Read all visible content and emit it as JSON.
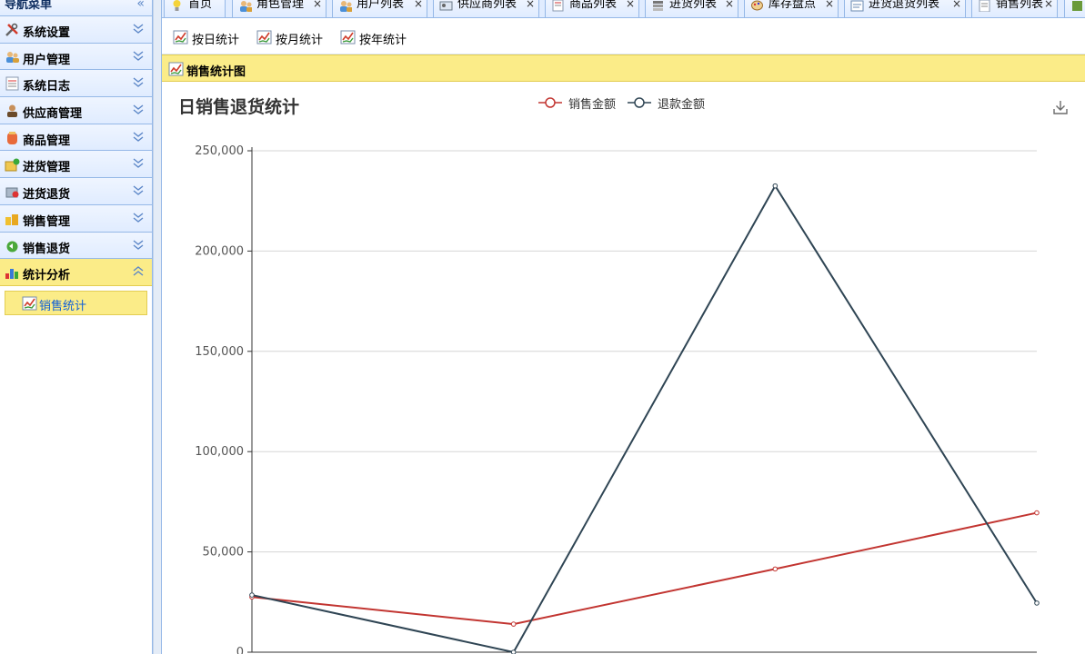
{
  "sidebar": {
    "title": "导航菜单",
    "collapse_glyph": "«",
    "panels": [
      {
        "label": "系统设置",
        "icon": "tools-icon",
        "active": false
      },
      {
        "label": "用户管理",
        "icon": "users-icon",
        "active": false
      },
      {
        "label": "系统日志",
        "icon": "log-icon",
        "active": false
      },
      {
        "label": "供应商管理",
        "icon": "supplier-icon",
        "active": false
      },
      {
        "label": "商品管理",
        "icon": "product-icon",
        "active": false
      },
      {
        "label": "进货管理",
        "icon": "purchase-icon",
        "active": false
      },
      {
        "label": "进货退货",
        "icon": "purchase-return-icon",
        "active": false
      },
      {
        "label": "销售管理",
        "icon": "sales-icon",
        "active": false
      },
      {
        "label": "销售退货",
        "icon": "sales-return-icon",
        "active": false
      },
      {
        "label": "统计分析",
        "icon": "bar-chart-icon",
        "active": true
      }
    ],
    "submenu": [
      {
        "label": "销售统计",
        "icon": "line-chart-icon"
      }
    ]
  },
  "tabs": [
    {
      "label": "首页",
      "icon": "bulb-icon",
      "closable": false
    },
    {
      "label": "角色管理",
      "icon": "users-icon",
      "closable": true
    },
    {
      "label": "用户列表",
      "icon": "users-icon",
      "closable": true
    },
    {
      "label": "供应商列表",
      "icon": "id-card-icon",
      "closable": true
    },
    {
      "label": "商品列表",
      "icon": "list-icon",
      "closable": true
    },
    {
      "label": "进货列表",
      "icon": "stack-icon",
      "closable": true
    },
    {
      "label": "库存盘点",
      "icon": "palette-icon",
      "closable": true
    },
    {
      "label": "进货退货列表",
      "icon": "form-icon",
      "closable": true
    },
    {
      "label": "销售列表",
      "icon": "doc-icon",
      "closable": true
    }
  ],
  "close_glyph": "×",
  "toolbar": {
    "buttons": [
      {
        "label": "按日统计",
        "icon": "line-chart-icon"
      },
      {
        "label": "按月统计",
        "icon": "line-chart-icon"
      },
      {
        "label": "按年统计",
        "icon": "line-chart-icon"
      }
    ]
  },
  "chart_panel": {
    "title": "销售统计图"
  },
  "colors": {
    "sales": "#c23531",
    "refund": "#2f4554",
    "accent": "#fbec88",
    "border": "#95b8e7"
  },
  "chart_data": {
    "type": "line",
    "title": "日销售退货统计",
    "categories": [
      "",
      "",
      "",
      ""
    ],
    "series": [
      {
        "name": "销售金额",
        "values": [
          27500,
          14000,
          41500,
          69500
        ]
      },
      {
        "name": "退款金额",
        "values": [
          28500,
          0,
          232500,
          24500
        ]
      }
    ],
    "ylim": [
      0,
      250000
    ],
    "yticks": [
      0,
      50000,
      100000,
      150000,
      200000,
      250000
    ],
    "ytick_labels": [
      "0",
      "50,000",
      "100,000",
      "150,000",
      "200,000",
      "250,000"
    ],
    "grid": true,
    "legend_position": "top-center"
  }
}
